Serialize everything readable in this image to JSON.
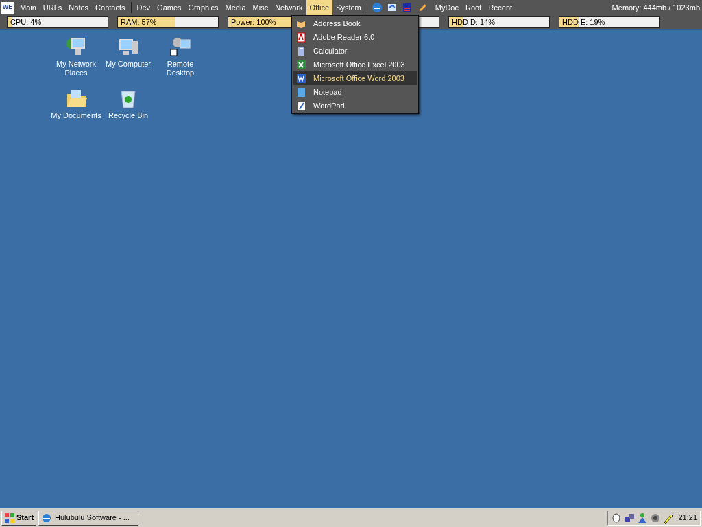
{
  "top_bar": {
    "logo": "WE",
    "menus_left": [
      {
        "label": "Main",
        "selected": false
      },
      {
        "label": "URLs",
        "selected": false
      },
      {
        "label": "Notes",
        "selected": false
      },
      {
        "label": "Contacts",
        "selected": false
      }
    ],
    "menus_middle": [
      {
        "label": "Dev",
        "selected": false
      },
      {
        "label": "Games",
        "selected": false
      },
      {
        "label": "Graphics",
        "selected": false
      },
      {
        "label": "Media",
        "selected": false
      },
      {
        "label": "Misc",
        "selected": false
      },
      {
        "label": "Network",
        "selected": false
      },
      {
        "label": "Office",
        "selected": true
      },
      {
        "label": "System",
        "selected": false
      }
    ],
    "menus_right": [
      {
        "label": "MyDoc",
        "selected": false
      },
      {
        "label": "Root",
        "selected": false
      },
      {
        "label": "Recent",
        "selected": false
      }
    ],
    "memory": "Memory: 444mb / 1023mb"
  },
  "meters": [
    {
      "kind": "meter",
      "label": "CPU: 4%",
      "level": 0.04
    },
    {
      "kind": "meter",
      "label": "RAM: 57%",
      "level": 0.57
    },
    {
      "kind": "meter",
      "label": "Power: 100%",
      "level": 1
    },
    {
      "kind": "meter"
    },
    {
      "kind": "meter",
      "label": "HDD D: 14%",
      "level": 0.14
    },
    {
      "kind": "meter",
      "label": "HDD E: 19%",
      "level": 0.19
    }
  ],
  "office_menu": [
    {
      "label": "Address Book",
      "selected": false
    },
    {
      "label": "Adobe Reader 6.0",
      "selected": false
    },
    {
      "label": "Calculator",
      "selected": false
    },
    {
      "label": "Microsoft Office Excel 2003",
      "selected": false
    },
    {
      "label": "Microsoft Office Word 2003",
      "selected": true
    },
    {
      "label": "Notepad",
      "selected": false
    },
    {
      "label": "WordPad",
      "selected": false
    }
  ],
  "desktop_icons": [
    {
      "label": "My Network Places"
    },
    {
      "label": "My Computer"
    },
    {
      "label": "Remote Desktop"
    },
    {
      "label": "My Documents"
    },
    {
      "label": "Recycle Bin"
    }
  ],
  "taskbar": {
    "start": "Start",
    "tasks": [
      {
        "label": "Hulubulu Software - ...",
        "selected": false
      }
    ],
    "clock": "21:21"
  }
}
